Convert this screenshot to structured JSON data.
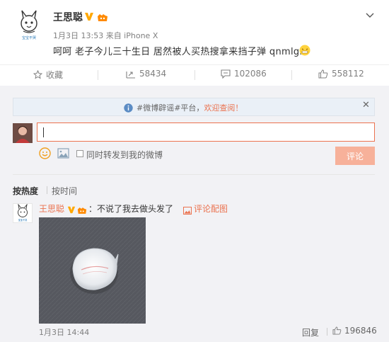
{
  "post": {
    "author": "王思聪",
    "meta": "1月3日 13:53 来自 iPhone X",
    "text": "呵呵 老子今儿三十生日 居然被人买热搜拿来挡子弹 qnmlgb",
    "avatar_caption": "宝宝不哭"
  },
  "actions": {
    "favorite": "收藏",
    "repost_count": "58434",
    "comment_count": "102086",
    "like_count": "558112"
  },
  "notice": {
    "prefix": "#微博辟谣#平台，",
    "highlight": "欢迎查阅！"
  },
  "composer": {
    "input_value": "",
    "repost_label": "同时转发到我的微博",
    "submit_label": "评论"
  },
  "sort": {
    "hot_label": "按热度",
    "time_label": "按时间"
  },
  "comment": {
    "author": "王思聪",
    "text": "：不说了我去做头发了",
    "pic_link": "评论配图",
    "time": "1月3日 14:44",
    "reply_label": "回复",
    "like_count": "196846",
    "avatar_caption": "宝宝不哭"
  },
  "colors": {
    "accent": "#eb7350",
    "verified": "#ffa800",
    "notice_bg": "#eaf0f7",
    "area_bg": "#f2f2f5"
  },
  "icons": [
    "chevron-down-icon",
    "verified-v-icon",
    "member-level-icon",
    "grin-emoji-icon",
    "star-icon",
    "repost-icon",
    "comment-icon",
    "thumb-up-icon",
    "info-icon",
    "close-icon",
    "smile-icon",
    "image-icon",
    "picture-link-icon"
  ]
}
